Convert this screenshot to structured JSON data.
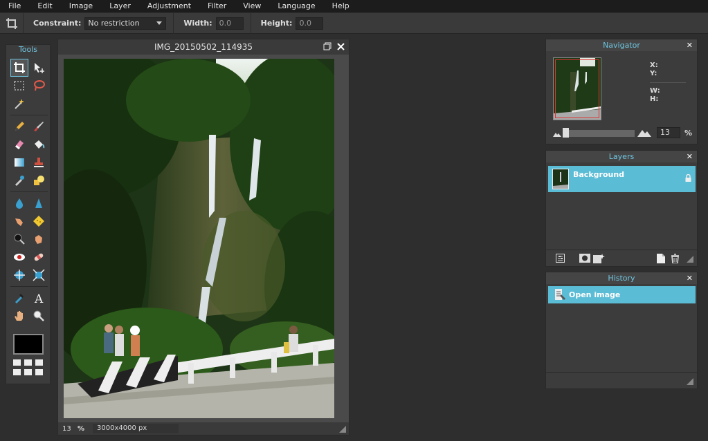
{
  "menu": [
    "File",
    "Edit",
    "Image",
    "Layer",
    "Adjustment",
    "Filter",
    "View",
    "Language",
    "Help"
  ],
  "options": {
    "constraint_label": "Constraint:",
    "constraint_value": "No restriction",
    "width_label": "Width:",
    "width_value": "0.0",
    "height_label": "Height:",
    "height_value": "0.0"
  },
  "tools": {
    "title": "Tools",
    "foreground_color": "#000000"
  },
  "image_window": {
    "title": "IMG_20150502_114935",
    "zoom": "13",
    "zoom_unit": "%",
    "dimensions": "3000x4000 px"
  },
  "navigator": {
    "title": "Navigator",
    "x_label": "X:",
    "y_label": "Y:",
    "w_label": "W:",
    "h_label": "H:",
    "zoom_value": "13",
    "zoom_unit": "%"
  },
  "layers": {
    "title": "Layers",
    "items": [
      {
        "name": "Background",
        "locked": true
      }
    ]
  },
  "history": {
    "title": "History",
    "items": [
      {
        "name": "Open image"
      }
    ]
  },
  "colors": {
    "accent": "#5bbcd6",
    "panel_title": "#6fc5e0"
  }
}
